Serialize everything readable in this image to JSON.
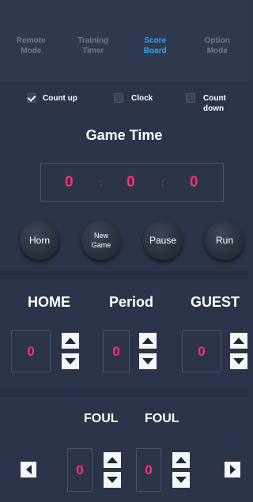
{
  "tabs": [
    {
      "label": "Remote\nMode",
      "active": false
    },
    {
      "label": "Training\nTimer",
      "active": false
    },
    {
      "label": "Score\nBoard",
      "active": true
    },
    {
      "label": "Option\nMode",
      "active": false
    }
  ],
  "modes": {
    "count_up": {
      "label": "Count up",
      "checked": true
    },
    "clock": {
      "label": "Clock",
      "checked": false
    },
    "count_down": {
      "label": "Count down",
      "checked": false
    }
  },
  "game_time": {
    "title": "Game Time",
    "minutes": "0",
    "seconds": "0",
    "tenths": "0",
    "separator": ":"
  },
  "controls": {
    "horn": "Horn",
    "new_game": "New\nGame",
    "pause": "Pause",
    "run": "Run"
  },
  "score": {
    "home_label": "HOME",
    "period_label": "Period",
    "guest_label": "GUEST",
    "home_value": "0",
    "period_value": "0",
    "guest_value": "0"
  },
  "fouls": {
    "home_label": "FOUL",
    "guest_label": "FOUL",
    "home_value": "0",
    "guest_value": "0"
  },
  "colors": {
    "background": "#2b3448",
    "accent": "#2aa9f0",
    "digit": "#ff2e73"
  },
  "icons": {
    "checkbox_on": "check-icon",
    "increment": "triangle-up-icon",
    "decrement": "triangle-down-icon",
    "left": "triangle-left-icon",
    "right": "triangle-right-icon"
  }
}
